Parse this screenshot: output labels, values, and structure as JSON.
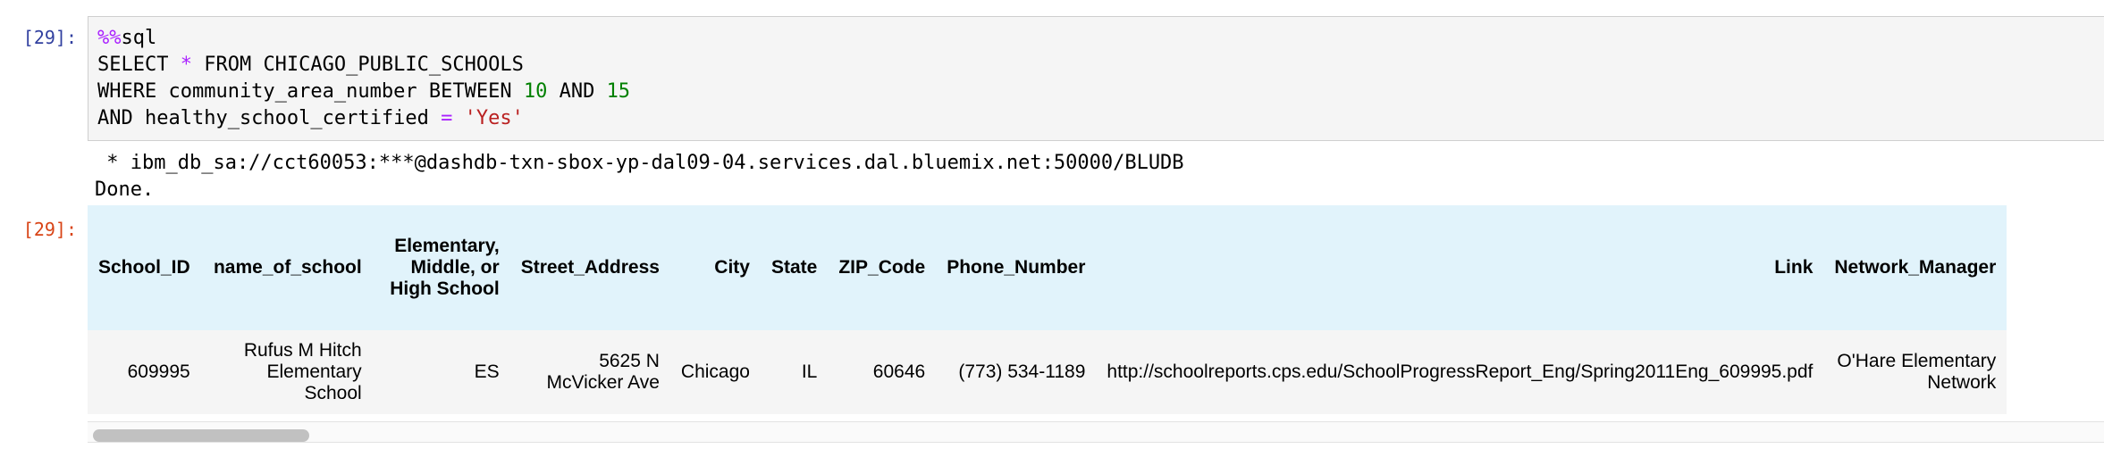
{
  "input_prompt": "[29]:",
  "output_prompt": "[29]:",
  "code": {
    "magic_pct": "%%",
    "magic_name": "sql",
    "l2_a": "SELECT ",
    "l2_star": "*",
    "l2_b": " FROM CHICAGO_PUBLIC_SCHOOLS",
    "l3_a": "WHERE community_area_number BETWEEN ",
    "l3_n1": "10",
    "l3_b": " AND ",
    "l3_n2": "15",
    "l4_a": "AND healthy_school_certified ",
    "l4_eq": "=",
    "l4_sp": " ",
    "l4_str": "'Yes'"
  },
  "stream": {
    "connection": " * ibm_db_sa://cct60053:***@dashdb-txn-sbox-yp-dal09-04.services.dal.bluemix.net:50000/BLUDB",
    "done": "Done."
  },
  "table": {
    "headers": [
      "School_ID",
      "name_of_school",
      "Elementary, Middle, or High School",
      "Street_Address",
      "City",
      "State",
      "ZIP_Code",
      "Phone_Number",
      "Link",
      "Network_Manager"
    ],
    "row": [
      "609995",
      "Rufus M Hitch Elementary School",
      "ES",
      "5625 N McVicker Ave",
      "Chicago",
      "IL",
      "60646",
      "(773) 534-1189",
      "http://schoolreports.cps.edu/SchoolProgressReport_Eng/Spring2011Eng_609995.pdf",
      "O'Hare Elementary Network"
    ]
  }
}
